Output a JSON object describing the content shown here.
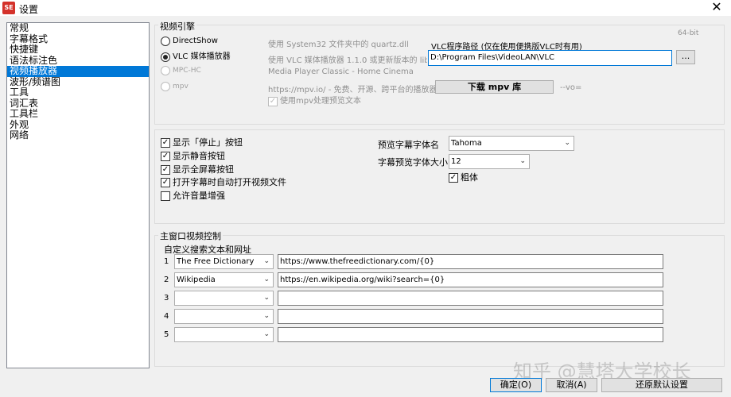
{
  "window": {
    "title": "设置",
    "app_icon_text": "SE",
    "close_glyph": "✕"
  },
  "sidebar": {
    "items": [
      {
        "label": "常规"
      },
      {
        "label": "字幕格式"
      },
      {
        "label": "快捷键"
      },
      {
        "label": "语法标注色"
      },
      {
        "label": "视频播放器",
        "selected": true
      },
      {
        "label": "波形/频谱图"
      },
      {
        "label": "工具"
      },
      {
        "label": "词汇表"
      },
      {
        "label": "工具栏"
      },
      {
        "label": "外观"
      },
      {
        "label": "网络"
      }
    ]
  },
  "engine": {
    "group_label": "视频引擎",
    "bitness": "64-bit",
    "options": [
      {
        "label": "DirectShow",
        "desc": "使用 System32 文件夹中的 quartz.dll",
        "checked": false,
        "enabled": true
      },
      {
        "label": "VLC 媒体播放器",
        "desc": "使用 VLC 媒体播放器 1.1.0 或更新版本的 libvlc",
        "checked": true,
        "enabled": true
      },
      {
        "label": "MPC-HC",
        "desc": "Media Player Classic - Home Cinema",
        "checked": false,
        "enabled": false
      },
      {
        "label": "mpv",
        "desc": "https://mpv.io/ - 免费、开源、跨平台的播放器",
        "checked": false,
        "enabled": false
      }
    ],
    "vlc_path_label": "VLC程序路径 (仅在使用便携版VLC时有用)",
    "vlc_path_value": "D:\\Program Files\\VideoLAN\\VLC",
    "browse_label": "...",
    "download_mpv_label": "下载 mpv 库",
    "mpv_vo": "--vo=",
    "mpv_preview_label": "使用mpv处理预览文本"
  },
  "options": {
    "checkboxes": [
      {
        "label": "显示「停止」按钮",
        "checked": true
      },
      {
        "label": "显示静音按钮",
        "checked": true
      },
      {
        "label": "显示全屏幕按钮",
        "checked": true
      },
      {
        "label": "打开字幕时自动打开视频文件",
        "checked": true
      },
      {
        "label": "允许音量增强",
        "checked": false
      }
    ],
    "preview_font_label": "预览字幕字体名",
    "preview_font_value": "Tahoma",
    "preview_size_label": "字幕预览字体大小",
    "preview_size_value": "12",
    "bold_label": "粗体",
    "bold_checked": true,
    "check_glyph": "✓"
  },
  "main_window": {
    "group_label": "主窗口视频控制",
    "search_label": "自定义搜索文本和网址",
    "rows": [
      {
        "num": "1",
        "name": "The Free Dictionary",
        "url": "https://www.thefreedictionary.com/{0}"
      },
      {
        "num": "2",
        "name": "Wikipedia",
        "url": "https://en.wikipedia.org/wiki?search={0}"
      },
      {
        "num": "3",
        "name": "",
        "url": ""
      },
      {
        "num": "4",
        "name": "",
        "url": ""
      },
      {
        "num": "5",
        "name": "",
        "url": ""
      }
    ],
    "arrow": "⌄"
  },
  "footer": {
    "ok_label": "确定(O)",
    "cancel_label": "取消(A)",
    "restore_label": "还原默认设置"
  },
  "watermark": "知乎 @慧塔大学校长"
}
